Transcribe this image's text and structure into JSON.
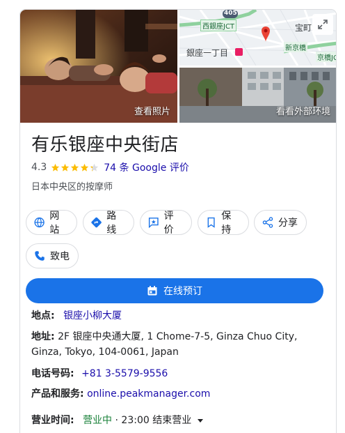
{
  "photos": {
    "main_label": "查看照片",
    "map_labels": {
      "route": "405",
      "jct": "西銀座JCT",
      "area1": "宝町",
      "area2": "銀座一丁目",
      "area3": "新京橋",
      "area4": "京橋JC"
    },
    "street_label": "看看外部环境"
  },
  "business": {
    "name": "有乐银座中央街店",
    "rating": "4.3",
    "rating_value": 4.3,
    "reviews_count": "74",
    "reviews_suffix": "条 Google 评价",
    "category": "日本中央区的按摩师"
  },
  "actions": {
    "website": "网站",
    "directions": "路线",
    "review": "评价",
    "save": "保持",
    "share": "分享",
    "call": "致电",
    "book": "在线预订"
  },
  "info": {
    "location_label": "地点:",
    "location_value": "银座小柳大厦",
    "address_label": "地址:",
    "address_value": "2F 银座中央通大厦, 1 Chome-7-5, Ginza Chuo City, Ginza, Tokyo, 104-0061, Japan",
    "phone_label": "电话号码:",
    "phone_value": "+81 3-5579-9556",
    "services_label": "产品和服务:",
    "services_value": "online.peakmanager.com",
    "hours_label": "营业时间:",
    "hours_status": "营业中",
    "hours_detail": "· 23:00 结束营业"
  },
  "colors": {
    "accent": "#1a73e8",
    "link": "#1a0dab",
    "star": "#fbbc04",
    "open": "#188038"
  }
}
